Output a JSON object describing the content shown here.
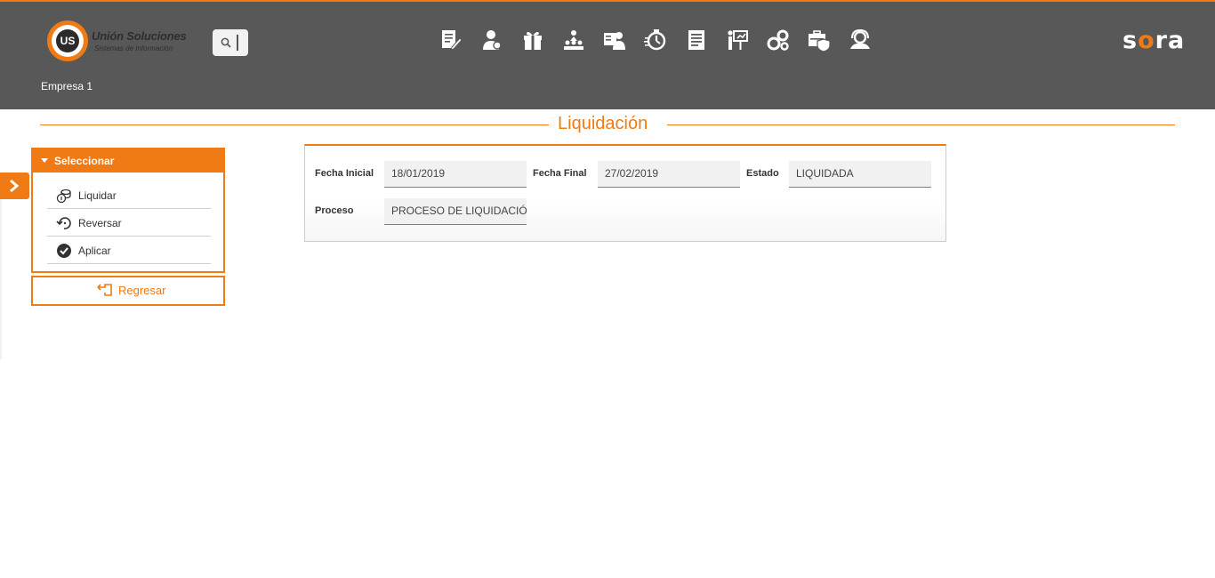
{
  "header": {
    "logo": {
      "title": "Unión Soluciones",
      "subtitle": "Sistemas de Información",
      "mark": "US"
    },
    "search_icon": "search-icon",
    "menu_icons": [
      "document-edit-icon",
      "person-icon",
      "gift-icon",
      "hierarchy-icon",
      "user-card-icon",
      "timer-icon",
      "report-icon",
      "presentation-icon",
      "gears-icon",
      "shield-case-icon",
      "support-icon"
    ],
    "brand": {
      "pre": "s",
      "o": "o",
      "post": "ra"
    },
    "company": "Empresa 1"
  },
  "page": {
    "title": "Liquidación"
  },
  "actions": {
    "header": "Seleccionar",
    "items": [
      {
        "label": "Liquidar",
        "icon": "coins-icon"
      },
      {
        "label": "Reversar",
        "icon": "undo-icon"
      },
      {
        "label": "Aplicar",
        "icon": "check-circle-icon"
      }
    ],
    "back": {
      "label": "Regresar",
      "icon": "return-icon"
    }
  },
  "form": {
    "fecha_inicial_label": "Fecha Inicial",
    "fecha_inicial_value": "18/01/2019",
    "fecha_final_label": "Fecha Final",
    "fecha_final_value": "27/02/2019",
    "estado_label": "Estado",
    "estado_value": "LIQUIDADA",
    "proceso_label": "Proceso",
    "proceso_value": "PROCESO DE LIQUIDACIÓN"
  },
  "colors": {
    "accent": "#f07a14",
    "header_bg": "#585858"
  }
}
